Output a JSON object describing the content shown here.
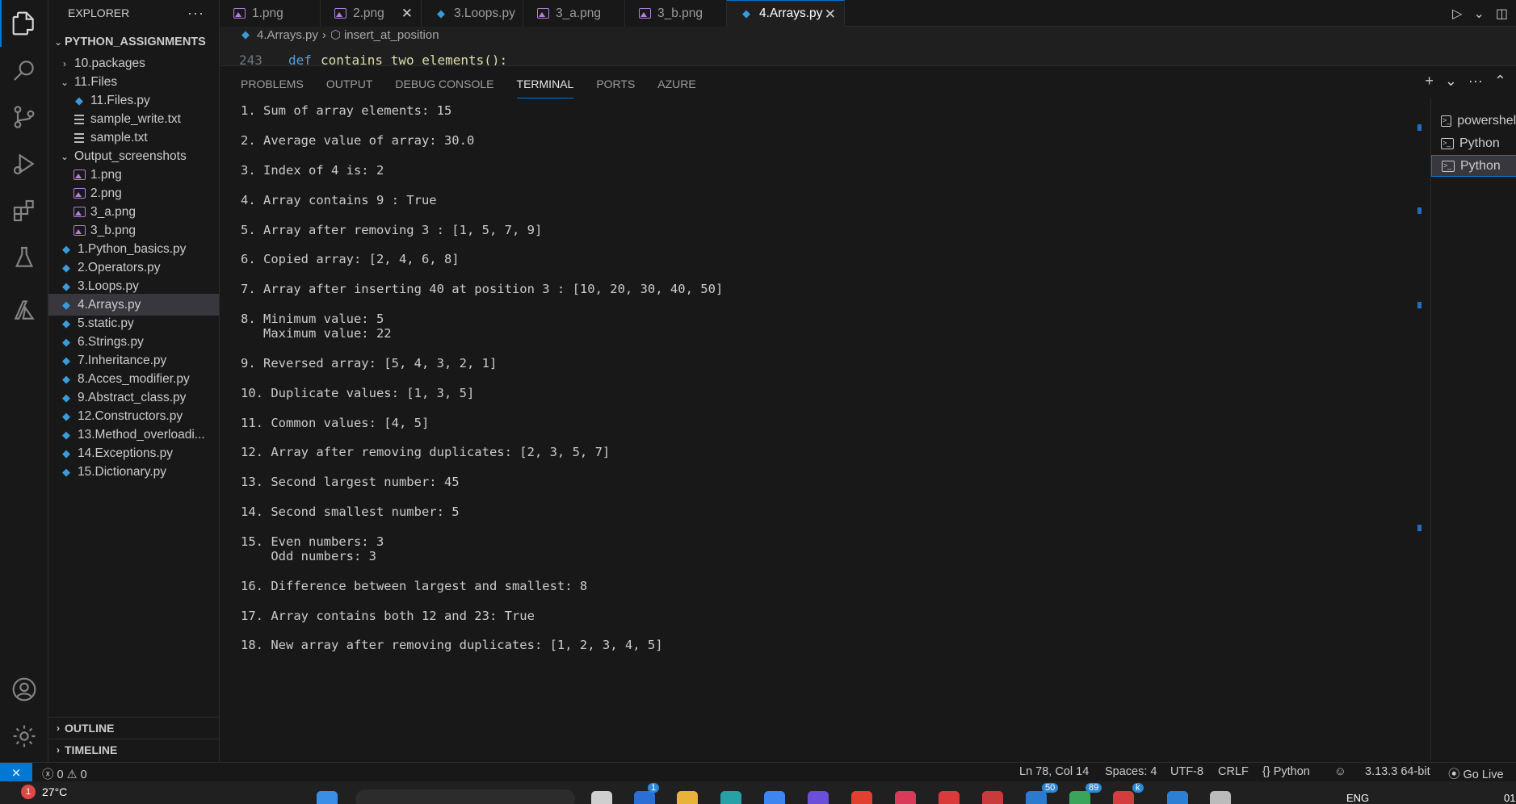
{
  "activity_bar": {
    "icons": [
      "explorer-icon",
      "search-icon",
      "source-control-icon",
      "run-debug-icon",
      "extensions-icon",
      "testing-icon",
      "azure-icon",
      "accounts-icon",
      "manage-gear-icon"
    ]
  },
  "sidebar": {
    "title": "EXPLORER",
    "more": "···",
    "root": "PYTHON_ASSIGNMENTS",
    "items": [
      {
        "label": "10.packages",
        "type": "folder",
        "expanded": false
      },
      {
        "label": "11.Files",
        "type": "folder",
        "expanded": true
      },
      {
        "label": "11.Files.py",
        "type": "py"
      },
      {
        "label": "sample_write.txt",
        "type": "txt"
      },
      {
        "label": "sample.txt",
        "type": "txt"
      },
      {
        "label": "Output_screenshots",
        "type": "folder",
        "expanded": true
      },
      {
        "label": "1.png",
        "type": "img"
      },
      {
        "label": "2.png",
        "type": "img"
      },
      {
        "label": "3_a.png",
        "type": "img"
      },
      {
        "label": "3_b.png",
        "type": "img"
      },
      {
        "label": "1.Python_basics.py",
        "type": "py"
      },
      {
        "label": "2.Operators.py",
        "type": "py"
      },
      {
        "label": "3.Loops.py",
        "type": "py"
      },
      {
        "label": "4.Arrays.py",
        "type": "py",
        "selected": true
      },
      {
        "label": "5.static.py",
        "type": "py"
      },
      {
        "label": "6.Strings.py",
        "type": "py"
      },
      {
        "label": "7.Inheritance.py",
        "type": "py"
      },
      {
        "label": "8.Acces_modifier.py",
        "type": "py"
      },
      {
        "label": "9.Abstract_class.py",
        "type": "py"
      },
      {
        "label": "12.Constructors.py",
        "type": "py"
      },
      {
        "label": "13.Method_overloadi...",
        "type": "py"
      },
      {
        "label": "14.Exceptions.py",
        "type": "py"
      },
      {
        "label": "15.Dictionary.py",
        "type": "py"
      }
    ],
    "outline": "OUTLINE",
    "timeline": "TIMELINE"
  },
  "tabs": [
    {
      "label": "1.png",
      "type": "img"
    },
    {
      "label": "2.png",
      "type": "img",
      "close": "✕"
    },
    {
      "label": "3.Loops.py",
      "type": "py"
    },
    {
      "label": "3_a.png",
      "type": "img"
    },
    {
      "label": "3_b.png",
      "type": "img"
    },
    {
      "label": "4.Arrays.py",
      "type": "py",
      "active": true,
      "close": "✕"
    }
  ],
  "breadcrumb": {
    "file": "4.Arrays.py",
    "separator": "›",
    "symbol": "insert_at_position"
  },
  "editor": {
    "line_number": "243",
    "keyword": "def",
    "code": "contains_two_elements():"
  },
  "panel": {
    "tabs": [
      "PROBLEMS",
      "OUTPUT",
      "DEBUG CONSOLE",
      "TERMINAL",
      "PORTS",
      "AZURE"
    ],
    "active_tab": "TERMINAL",
    "actions": [
      "+",
      "⌄",
      "···",
      "⌃"
    ]
  },
  "terminal": {
    "lines": [
      "1. Sum of array elements: 15",
      "2. Average value of array: 30.0",
      "3. Index of 4 is: 2",
      "4. Array contains 9 : True",
      "5. Array after removing 3 : [1, 5, 7, 9]",
      "6. Copied array: [2, 4, 6, 8]",
      "7. Array after inserting 40 at position 3 : [10, 20, 30, 40, 50]",
      "8. Minimum value: 5",
      "   Maximum value: 22",
      "9. Reversed array: [5, 4, 3, 2, 1]",
      "10. Duplicate values: [1, 3, 5]",
      "11. Common values: [4, 5]",
      "12. Array after removing duplicates: [2, 3, 5, 7]",
      "13. Second largest number: 45",
      "14. Second smallest number: 5",
      "15. Even numbers: 3",
      "    Odd numbers: 3",
      "16. Difference between largest and smallest: 8",
      "17. Array contains both 12 and 23: True",
      "18. New array after removing duplicates: [1, 2, 3, 4, 5]"
    ],
    "sessions": [
      {
        "label": "powershell"
      },
      {
        "label": "Python"
      },
      {
        "label": "Python",
        "selected": true
      }
    ]
  },
  "statusbar": {
    "remote_icon": "⨯",
    "errors": "0",
    "warnings": "0",
    "position": "Ln 78, Col 14",
    "spaces": "Spaces: 4",
    "encoding": "UTF-8",
    "eol": "CRLF",
    "language": "Python",
    "python_version": "3.13.3 64-bit",
    "go_live": "Go Live"
  },
  "taskbar": {
    "weather": "27°C",
    "weather_badge": "1",
    "badges": [
      "1",
      "50",
      "89",
      "k"
    ],
    "language": "ENG",
    "time": "01"
  }
}
